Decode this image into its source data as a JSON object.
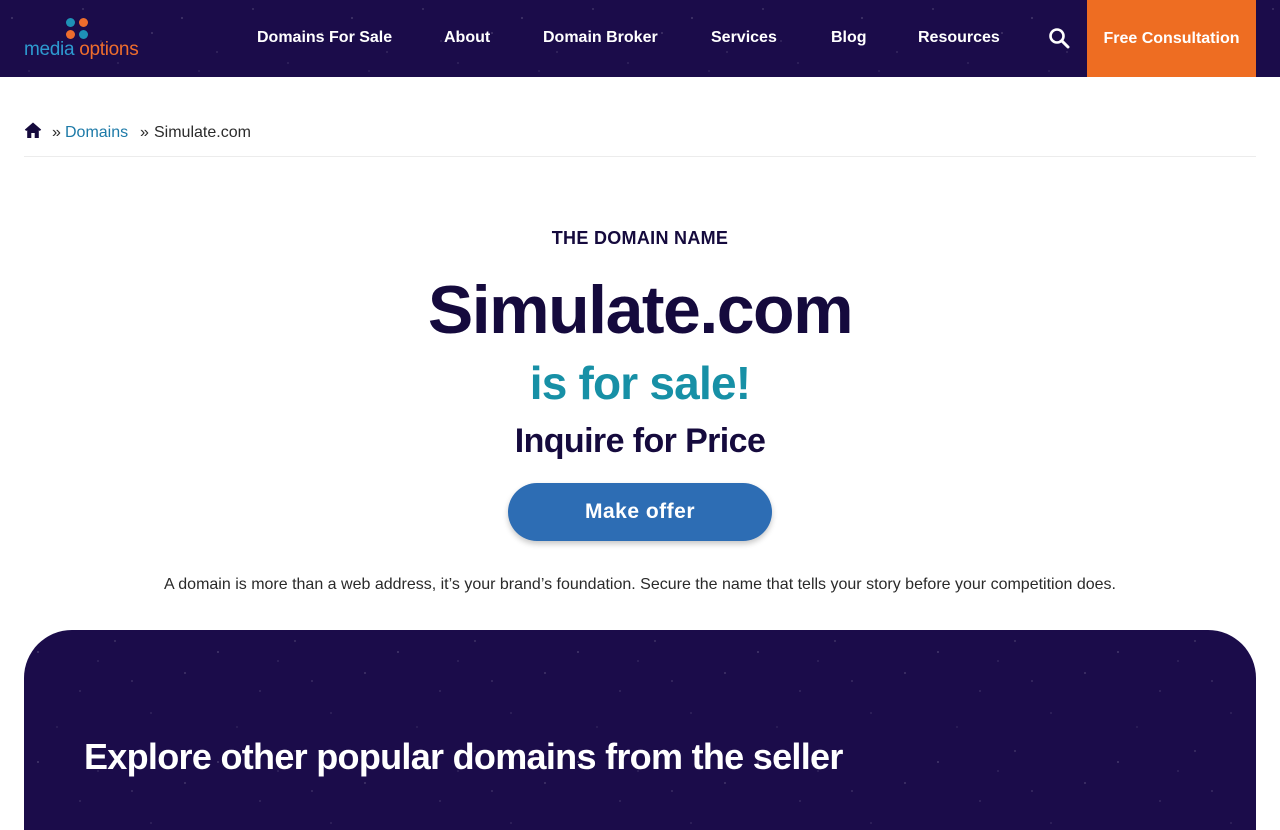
{
  "header": {
    "logo": {
      "word1": "media",
      "word2": "options"
    },
    "nav": [
      {
        "label": "Domains For Sale"
      },
      {
        "label": "About"
      },
      {
        "label": "Domain Broker"
      },
      {
        "label": "Services"
      },
      {
        "label": "Blog"
      },
      {
        "label": "Resources"
      }
    ],
    "search_icon": "search-icon",
    "cta_label": "Free Consultation"
  },
  "breadcrumb": {
    "home_icon": "home-icon",
    "separator": "»",
    "link": "Domains",
    "current": "Simulate.com"
  },
  "hero": {
    "eyebrow": "THE DOMAIN NAME",
    "domain": "Simulate.com",
    "for_sale": "is for sale!",
    "price": "Inquire for Price",
    "offer_button": "Make offer",
    "tagline": "A domain is more than a web address, it’s your brand’s foundation. Secure the name that tells your story before your competition does."
  },
  "panel": {
    "title": "Explore other popular domains from the seller"
  },
  "colors": {
    "navy": "#1b0c4a",
    "orange": "#ee6d22",
    "teal": "#1790a6",
    "button_blue": "#2d6db4",
    "link_blue": "#1d7aa8"
  }
}
